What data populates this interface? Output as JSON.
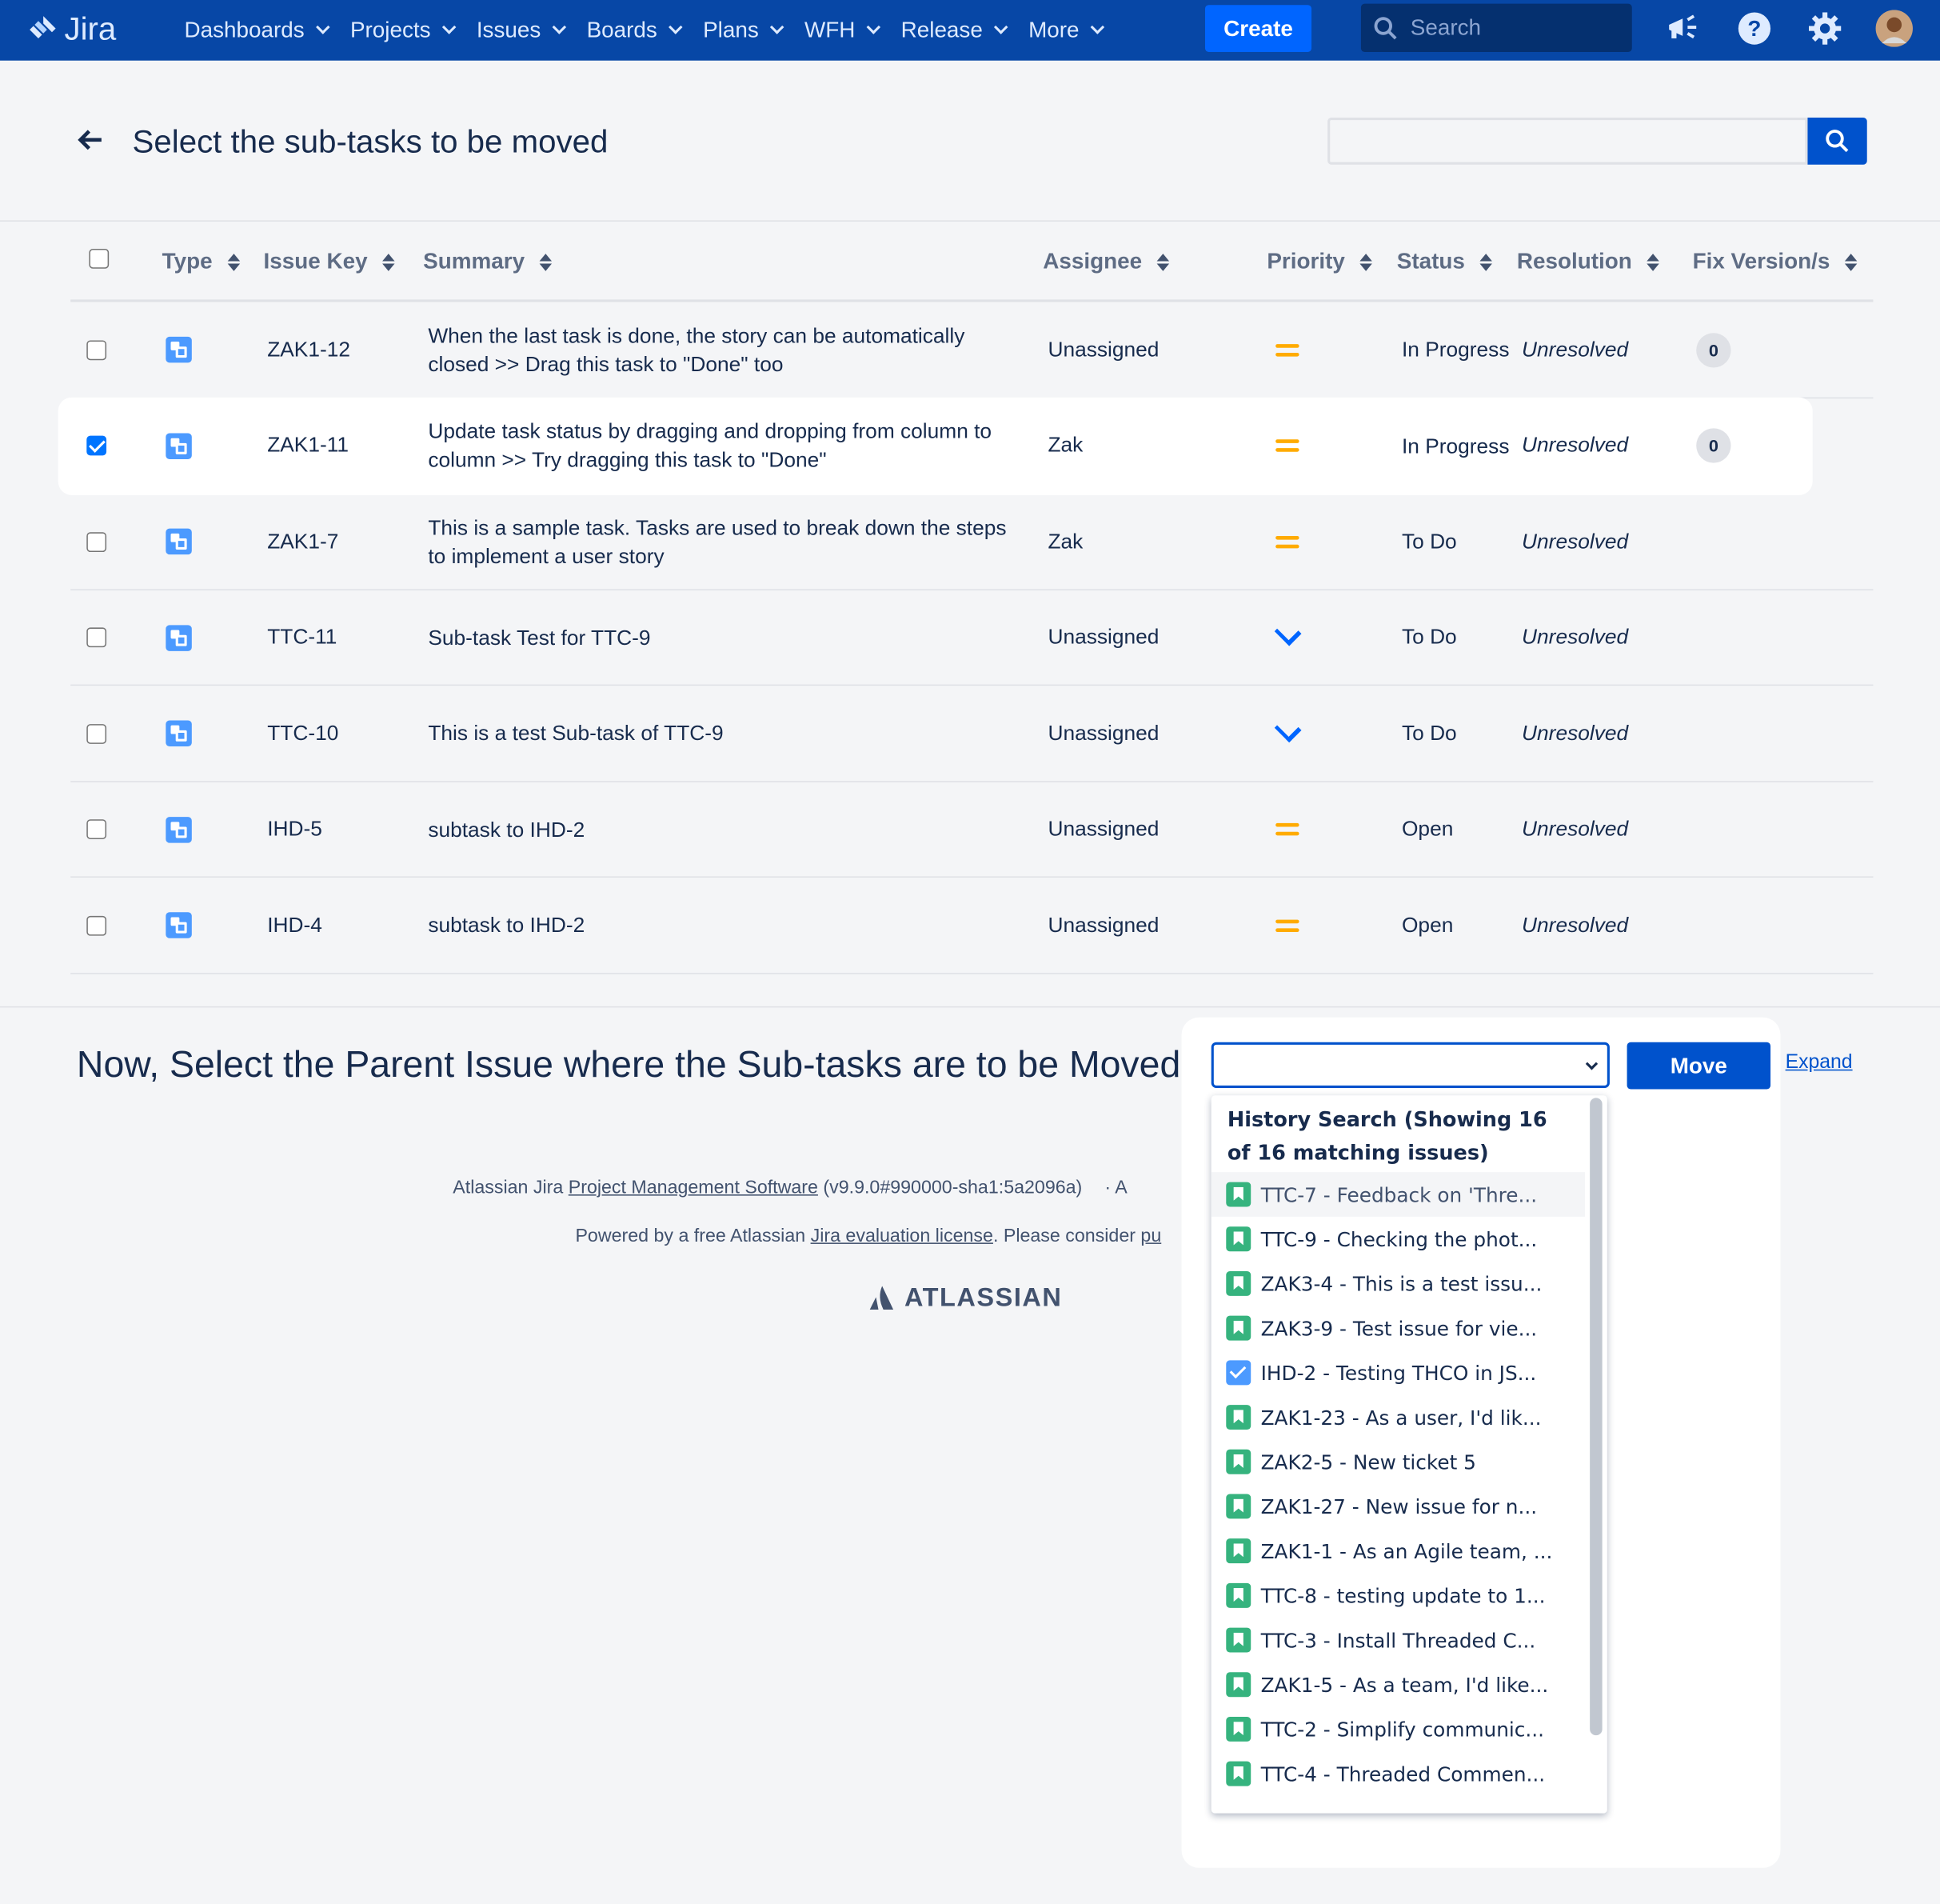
{
  "topbar": {
    "logo_text": "Jira",
    "nav": [
      {
        "label": "Dashboards"
      },
      {
        "label": "Projects"
      },
      {
        "label": "Issues"
      },
      {
        "label": "Boards"
      },
      {
        "label": "Plans"
      },
      {
        "label": "WFH"
      },
      {
        "label": "Release"
      },
      {
        "label": "More"
      }
    ],
    "create_label": "Create",
    "search_placeholder": "Search",
    "icons": [
      "megaphone-icon",
      "help-icon",
      "gear-icon",
      "avatar"
    ]
  },
  "page": {
    "title": "Select the sub-tasks to be moved",
    "filter_value": ""
  },
  "table": {
    "headers": {
      "type": "Type",
      "key": "Issue Key",
      "summary": "Summary",
      "assignee": "Assignee",
      "priority": "Priority",
      "status": "Status",
      "resolution": "Resolution",
      "fix": "Fix Version/s"
    },
    "rows": [
      {
        "checked": false,
        "key": "ZAK1-12",
        "summary": "When the last task is done, the story can be automatically closed >> Drag this task to \"Done\" too",
        "assignee": "Unassigned",
        "priority": "medium",
        "status": "In Progress",
        "resolution": "Unresolved",
        "fix": "0"
      },
      {
        "checked": true,
        "key": "ZAK1-11",
        "summary": "Update task status by dragging and dropping from column to column >> Try dragging this task to \"Done\"",
        "assignee": "Zak",
        "priority": "medium",
        "status": "In Progress",
        "resolution": "Unresolved",
        "fix": "0"
      },
      {
        "checked": false,
        "key": "ZAK1-7",
        "summary": "This is a sample task. Tasks are used to break down the steps to implement a user story",
        "assignee": "Zak",
        "priority": "medium",
        "status": "To Do",
        "resolution": "Unresolved",
        "fix": ""
      },
      {
        "checked": false,
        "key": "TTC-11",
        "summary": "Sub-task Test for TTC-9",
        "assignee": "Unassigned",
        "priority": "low",
        "status": "To Do",
        "resolution": "Unresolved",
        "fix": ""
      },
      {
        "checked": false,
        "key": "TTC-10",
        "summary": "This is a test Sub-task of TTC-9",
        "assignee": "Unassigned",
        "priority": "low",
        "status": "To Do",
        "resolution": "Unresolved",
        "fix": ""
      },
      {
        "checked": false,
        "key": "IHD-5",
        "summary": "subtask to IHD-2",
        "assignee": "Unassigned",
        "priority": "medium",
        "status": "Open",
        "resolution": "Unresolved",
        "fix": ""
      },
      {
        "checked": false,
        "key": "IHD-4",
        "summary": "subtask to IHD-2",
        "assignee": "Unassigned",
        "priority": "medium",
        "status": "Open",
        "resolution": "Unresolved",
        "fix": ""
      }
    ]
  },
  "section2": {
    "title": "Now, Select the Parent Issue where the Sub-tasks are to be Moved",
    "move_label": "Move",
    "expand_label": "Expand",
    "dropdown_header": "History Search (Showing 16 of 16 matching issues)",
    "options": [
      {
        "icon": "story-icon",
        "text": "TTC-7 - Feedback on 'Thre..."
      },
      {
        "icon": "story-icon",
        "text": "TTC-9 - Checking the phot..."
      },
      {
        "icon": "story-icon",
        "text": "ZAK3-4 - This is a test issu..."
      },
      {
        "icon": "story-icon",
        "text": "ZAK3-9 - Test issue for vie..."
      },
      {
        "icon": "task-check-icon",
        "text": "IHD-2 - Testing THCO in JS..."
      },
      {
        "icon": "story-icon",
        "text": "ZAK1-23 - As a user, I'd lik..."
      },
      {
        "icon": "story-icon",
        "text": "ZAK2-5 - New ticket 5"
      },
      {
        "icon": "story-icon",
        "text": "ZAK1-27 - New issue for n..."
      },
      {
        "icon": "story-icon",
        "text": "ZAK1-1 - As an Agile team, ..."
      },
      {
        "icon": "story-icon",
        "text": "TTC-8 - testing update to 1..."
      },
      {
        "icon": "story-icon",
        "text": "TTC-3 - Install Threaded C..."
      },
      {
        "icon": "story-icon",
        "text": "ZAK1-5 - As a team, I'd like..."
      },
      {
        "icon": "story-icon",
        "text": "TTC-2 - Simplify communic..."
      },
      {
        "icon": "story-icon",
        "text": "TTC-4 - Threaded Commen..."
      }
    ]
  },
  "footer": {
    "line1_prefix": "Atlassian Jira ",
    "line1_link": "Project Management Software",
    "line1_suffix": " (v9.9.0#990000-sha1:5a2096a)",
    "line1_tail": "·  A",
    "line2_prefix": "Powered by a free Atlassian ",
    "line2_link": "Jira evaluation license",
    "line2_suffix": ". Please consider ",
    "line2_tail": "pu",
    "logo_text": "ATLASSIAN"
  }
}
